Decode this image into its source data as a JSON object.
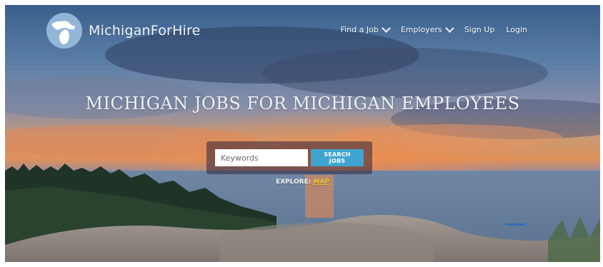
{
  "brand": {
    "name": "MichiganForHire"
  },
  "nav": {
    "find_job": "Find a Job",
    "employers": "Employers",
    "sign_up": "Sign Up",
    "login": "Login"
  },
  "hero": {
    "headline": "MICHIGAN JOBS FOR MICHIGAN EMPLOYEES"
  },
  "search": {
    "placeholder": "Keywords",
    "button_label": "SEARCH JOBS"
  },
  "explore": {
    "label": "EXPLORE:",
    "link_label": "MAP"
  },
  "colors": {
    "accent": "#3fa4d0",
    "link": "#f1c233"
  },
  "icons": {
    "logo": "michigan-map-logo-icon",
    "dropdown": "chevron-down-icon"
  }
}
